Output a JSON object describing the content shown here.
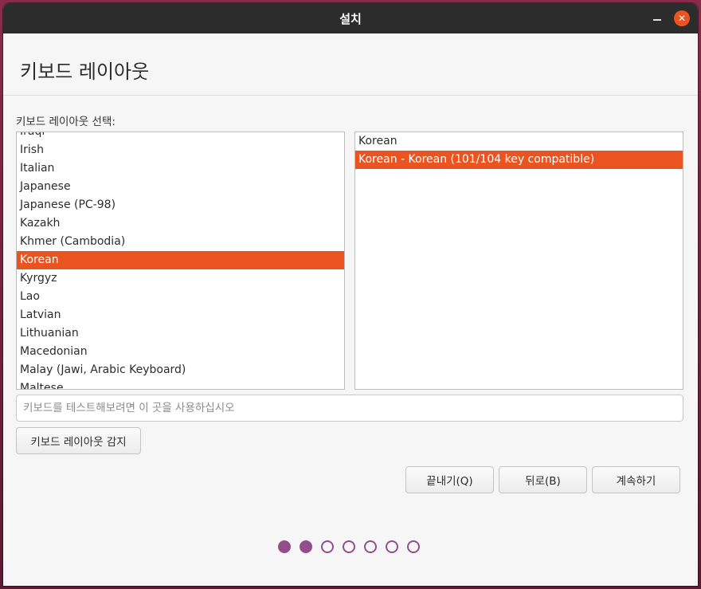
{
  "window": {
    "title": "설치",
    "close_glyph": "✕"
  },
  "header": {
    "title": "키보드 레이아웃"
  },
  "layout_select": {
    "label": "키보드 레이아웃 선택:"
  },
  "languages": {
    "items": [
      "Iraqi",
      "Irish",
      "Italian",
      "Japanese",
      "Japanese (PC-98)",
      "Kazakh",
      "Khmer (Cambodia)",
      "Korean",
      "Kyrgyz",
      "Lao",
      "Latvian",
      "Lithuanian",
      "Macedonian",
      "Malay (Jawi, Arabic Keyboard)",
      "Maltese"
    ],
    "selected": "Korean"
  },
  "variants": {
    "items": [
      "Korean",
      "Korean - Korean (101/104 key compatible)"
    ],
    "selected": "Korean - Korean (101/104 key compatible)"
  },
  "test_input": {
    "placeholder": "키보드를 테스트해보려면 이 곳을 사용하십시오",
    "value": ""
  },
  "buttons": {
    "detect": "키보드 레이아웃 감지",
    "quit": "끝내기(Q)",
    "back": "뒤로(B)",
    "continue": "계속하기"
  },
  "progress": {
    "total_steps": 7,
    "current_step": 2
  },
  "colors": {
    "accent": "#e95420",
    "progress_dot": "#924d8b",
    "titlebar": "#2c2c2c"
  }
}
